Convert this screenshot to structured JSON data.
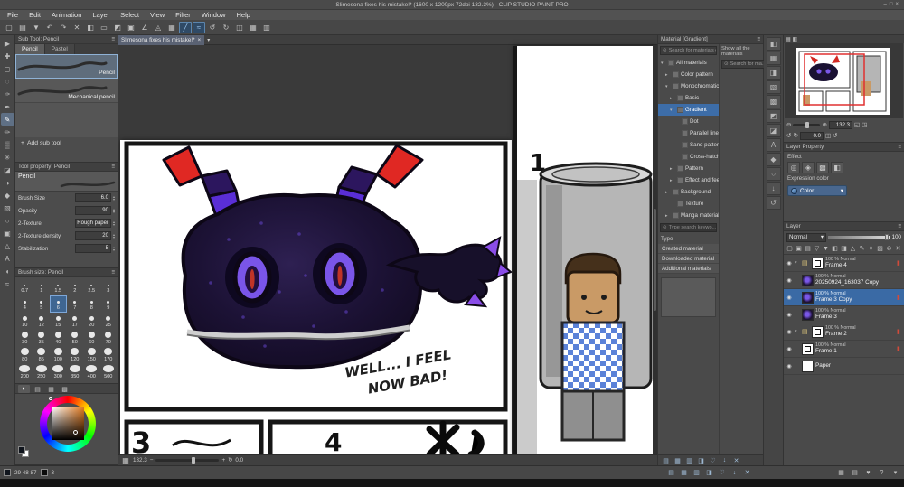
{
  "titlebar": {
    "title": "Slimesona fixes his mistake!* (1600 x 1200px 72dpi 132.3%) - CLIP STUDIO PAINT PRO",
    "minimize": "–",
    "maximize": "□",
    "close": "×"
  },
  "common": {
    "menu_icon": "≡",
    "eye_icon": "◉",
    "collapse_icon": "▾",
    "expand_icon": "▸",
    "pin_icon": "▮",
    "search_icon": "⊙",
    "plus_icon": "+",
    "up_icon": "▴",
    "down_icon": "▾",
    "close_icon": "×"
  },
  "colors": {
    "accent_blue": "#3a6aa5",
    "selection_red": "#e03030",
    "selected_color_orange": "#e0781e",
    "panel_gray": "#4a4a4a"
  },
  "menu": {
    "items": [
      "File",
      "Edit",
      "Animation",
      "Layer",
      "Select",
      "View",
      "Filter",
      "Window",
      "Help"
    ]
  },
  "toolbar": {
    "icons": [
      {
        "dn": "new-file-icon",
        "glyph": "▢"
      },
      {
        "dn": "open-file-icon",
        "glyph": "▤"
      },
      {
        "dn": "save-icon",
        "glyph": "▼"
      },
      {
        "dn": "undo-icon",
        "glyph": "↶"
      },
      {
        "dn": "redo-icon",
        "glyph": "↷"
      },
      {
        "dn": "delete-icon",
        "glyph": "✕"
      },
      {
        "dn": "fill-icon",
        "glyph": "◧"
      },
      {
        "dn": "deselect-icon",
        "glyph": "▭"
      },
      {
        "dn": "invert-selection-icon",
        "glyph": "◩"
      },
      {
        "dn": "selection-border-icon",
        "glyph": "▣"
      },
      {
        "dn": "snap-to-ruler-icon",
        "glyph": "∠"
      },
      {
        "dn": "snap-to-special-ruler-icon",
        "glyph": "◬"
      },
      {
        "dn": "snap-to-grid-icon",
        "glyph": "▦"
      },
      {
        "dn": "vector-snap-line-icon",
        "glyph": "╱",
        "active": true
      },
      {
        "dn": "vector-snap-curve-icon",
        "glyph": "≈",
        "active": true
      },
      {
        "dn": "rotate-left-icon",
        "glyph": "↺"
      },
      {
        "dn": "rotate-right-icon",
        "glyph": "↻"
      },
      {
        "dn": "flip-horizontal-icon",
        "glyph": "◫"
      },
      {
        "dn": "show-grid-icon",
        "glyph": "▦"
      },
      {
        "dn": "show-ruler-icon",
        "glyph": "▥"
      }
    ]
  },
  "tools": {
    "items": [
      {
        "dn": "operation-tool-icon",
        "glyph": "▶"
      },
      {
        "dn": "move-tool-icon",
        "glyph": "✚"
      },
      {
        "dn": "marquee-tool-icon",
        "glyph": "◻"
      },
      {
        "dn": "lasso-tool-icon",
        "glyph": "◌"
      },
      {
        "dn": "eyedropper-tool-icon",
        "glyph": "✑"
      },
      {
        "dn": "pen-tool-icon",
        "glyph": "✒"
      },
      {
        "dn": "pencil-tool-icon",
        "glyph": "✎",
        "active": true
      },
      {
        "dn": "brush-tool-icon",
        "glyph": "✏"
      },
      {
        "dn": "airbrush-tool-icon",
        "glyph": "▒"
      },
      {
        "dn": "decoration-tool-icon",
        "glyph": "✳"
      },
      {
        "dn": "eraser-tool-icon",
        "glyph": "◪"
      },
      {
        "dn": "blend-tool-icon",
        "glyph": "◑"
      },
      {
        "dn": "fill-tool-icon",
        "glyph": "◆"
      },
      {
        "dn": "gradient-tool-icon",
        "glyph": "▧"
      },
      {
        "dn": "figure-tool-icon",
        "glyph": "○"
      },
      {
        "dn": "frame-border-tool-icon",
        "glyph": "▣"
      },
      {
        "dn": "ruler-tool-icon",
        "glyph": "△"
      },
      {
        "dn": "text-tool-icon",
        "glyph": "A"
      },
      {
        "dn": "balloon-tool-icon",
        "glyph": "◖"
      },
      {
        "dn": "line-correction-tool-icon",
        "glyph": "≈"
      }
    ]
  },
  "subtool": {
    "title": "Sub Tool: Pencil",
    "tabs": [
      {
        "dn": "subtool-tab-pencil",
        "label": "Pencil",
        "active": true
      },
      {
        "dn": "subtool-tab-pastel",
        "label": "Pastel"
      }
    ],
    "items": [
      {
        "dn": "subtool-item-pencil",
        "name": "Pencil",
        "selected": true
      },
      {
        "dn": "subtool-item-mechanical-pencil",
        "name": "Mechanical pencil"
      }
    ],
    "add_label": "Add sub tool"
  },
  "tool_property": {
    "title": "Tool property: Pencil",
    "tool_name": "Pencil",
    "props": [
      {
        "dn": "brush-size-field",
        "label": "Brush Size",
        "value": "6.0"
      },
      {
        "dn": "opacity-field",
        "label": "Opacity",
        "value": "90"
      },
      {
        "dn": "texture-field",
        "label": "2-Texture",
        "value": "Rough paper"
      },
      {
        "dn": "texture-density-field",
        "label": "2-Texture density",
        "value": "20"
      },
      {
        "dn": "stabilization-field",
        "label": "Stabilization",
        "value": "5"
      }
    ]
  },
  "brush_size": {
    "title": "Brush size: Pencil",
    "sizes": [
      {
        "v": "0.7"
      },
      {
        "v": "1"
      },
      {
        "v": "1.5"
      },
      {
        "v": "2"
      },
      {
        "v": "2.5"
      },
      {
        "v": "3"
      },
      {
        "v": "4"
      },
      {
        "v": "5"
      },
      {
        "v": "6",
        "selected": true
      },
      {
        "v": "7"
      },
      {
        "v": "8"
      },
      {
        "v": "9"
      },
      {
        "v": "10"
      },
      {
        "v": "12"
      },
      {
        "v": "15"
      },
      {
        "v": "17"
      },
      {
        "v": "20"
      },
      {
        "v": "25"
      },
      {
        "v": "30"
      },
      {
        "v": "35"
      },
      {
        "v": "40"
      },
      {
        "v": "50"
      },
      {
        "v": "60"
      },
      {
        "v": "70"
      },
      {
        "v": "80"
      },
      {
        "v": "85"
      },
      {
        "v": "100"
      },
      {
        "v": "120"
      },
      {
        "v": "150"
      },
      {
        "v": "170"
      },
      {
        "v": "200"
      },
      {
        "v": "250"
      },
      {
        "v": "300"
      },
      {
        "v": "350"
      },
      {
        "v": "400"
      },
      {
        "v": "500"
      }
    ]
  },
  "color_panel": {
    "selected_color": "#e0781e",
    "tab_icons": [
      {
        "dn": "color-wheel-tab-icon",
        "glyph": "◐",
        "active": true
      },
      {
        "dn": "color-slider-tab-icon",
        "glyph": "▤"
      },
      {
        "dn": "color-set-tab-icon",
        "glyph": "▦"
      },
      {
        "dn": "intermediate-color-tab-icon",
        "glyph": "▩"
      }
    ]
  },
  "canvas": {
    "doc_tab": "Slimesona fixes his mistake!*",
    "zoom_value": "132.3",
    "rotate_value": "0.0",
    "speech_line1": "WELL... I FEEL",
    "speech_line2": "NOW BAD!",
    "panel1_label": "1",
    "panel3_label": "3",
    "panel4_label": "4"
  },
  "material": {
    "title": "Material [Gradient]",
    "search_placeholder": "Search for materials on ...",
    "show_all_label": "Show all the materials",
    "side_search_label": "Search for ma...",
    "tree": [
      {
        "dn": "material-tree-all-materials",
        "exp": "▾",
        "label": "All materials",
        "lvl": 0
      },
      {
        "dn": "material-tree-color-pattern",
        "exp": "▸",
        "label": "Color pattern",
        "lvl": 1
      },
      {
        "dn": "material-tree-monochromatic",
        "exp": "▾",
        "label": "Monochromatic",
        "lvl": 1
      },
      {
        "dn": "material-tree-basic",
        "exp": "▸",
        "label": "Basic",
        "lvl": 2
      },
      {
        "dn": "material-tree-gradient",
        "exp": "▾",
        "label": "Gradient",
        "lvl": 2,
        "selected": true
      },
      {
        "dn": "material-tree-dot",
        "exp": "",
        "label": "Dot",
        "lvl": 3
      },
      {
        "dn": "material-tree-parallel-lines",
        "exp": "",
        "label": "Parallel lines",
        "lvl": 3
      },
      {
        "dn": "material-tree-sand-pattern",
        "exp": "",
        "label": "Sand pattern",
        "lvl": 3
      },
      {
        "dn": "material-tree-cross-hatching",
        "exp": "",
        "label": "Cross-hatching",
        "lvl": 3
      },
      {
        "dn": "material-tree-pattern",
        "exp": "▸",
        "label": "Pattern",
        "lvl": 2
      },
      {
        "dn": "material-tree-effect-and-feeling",
        "exp": "▸",
        "label": "Effect and feeling",
        "lvl": 2
      },
      {
        "dn": "material-tree-background",
        "exp": "▸",
        "label": "Background",
        "lvl": 1
      },
      {
        "dn": "material-tree-texture",
        "exp": "",
        "label": "Texture",
        "lvl": 2
      },
      {
        "dn": "material-tree-manga-material",
        "exp": "▸",
        "label": "Manga material",
        "lvl": 1
      }
    ],
    "search2_placeholder": "Type search keywo...",
    "type_label": "Type",
    "type_items": [
      "Created material",
      "Downloaded material",
      "Additional materials"
    ],
    "footer_icons": [
      {
        "dn": "material-list-view-icon",
        "glyph": "▤"
      },
      {
        "dn": "material-grid-view-icon",
        "glyph": "▦"
      },
      {
        "dn": "material-detail-view-icon",
        "glyph": "▥"
      },
      {
        "dn": "material-paste-icon",
        "glyph": "◨"
      },
      {
        "dn": "material-favorite-icon",
        "glyph": "♡"
      },
      {
        "dn": "material-download-icon",
        "glyph": "↓"
      },
      {
        "dn": "material-delete-icon",
        "glyph": "✕"
      }
    ]
  },
  "side_strip": {
    "icons": [
      {
        "dn": "quick-access-tab-icon",
        "glyph": "◧"
      },
      {
        "dn": "material-color-pattern-tab-icon",
        "glyph": "▦"
      },
      {
        "dn": "material-monochromatic-tab-icon",
        "glyph": "◨"
      },
      {
        "dn": "material-gradient-tab-icon",
        "glyph": "▧"
      },
      {
        "dn": "material-manga-tab-icon",
        "glyph": "▩"
      },
      {
        "dn": "material-image-tab-icon",
        "glyph": "◩"
      },
      {
        "dn": "material-3d-tab-icon",
        "glyph": "◪"
      },
      {
        "dn": "material-text-tab-icon",
        "glyph": "A"
      },
      {
        "dn": "material-pose-tab-icon",
        "glyph": "◆"
      },
      {
        "dn": "material-primitive-tab-icon",
        "glyph": "○"
      },
      {
        "dn": "material-download-tab-icon",
        "glyph": "↓"
      },
      {
        "dn": "material-history-tab-icon",
        "glyph": "↺"
      }
    ]
  },
  "navigator": {
    "zoom_out_icon": "⊖",
    "zoom_in_icon": "⊕",
    "zoom_value": "132.3",
    "fit_icon": "◱",
    "full_icon": "◳",
    "rotate_left_icon": "↺",
    "rotate_right_icon": "↻",
    "rotate_value": "0.0",
    "flip_icon": "◫",
    "tab1_icon": "▦",
    "tab2_icon": "◧"
  },
  "layer_property": {
    "title": "Layer Property",
    "effect_label": "Effect",
    "effect_icons": [
      {
        "dn": "border-effect-icon",
        "glyph": "◎"
      },
      {
        "dn": "extract-line-icon",
        "glyph": "◈"
      },
      {
        "dn": "tone-effect-icon",
        "glyph": "▩"
      },
      {
        "dn": "layer-color-icon",
        "glyph": "◧"
      }
    ],
    "expression_label": "Expression color",
    "expression_value": "Color"
  },
  "layers": {
    "title": "Layer",
    "blend_mode": "Normal",
    "opacity_value": "100",
    "header_icons": [
      {
        "dn": "new-raster-layer-icon",
        "glyph": "▢"
      },
      {
        "dn": "new-vector-layer-icon",
        "glyph": "▣"
      },
      {
        "dn": "new-folder-icon",
        "glyph": "▤"
      },
      {
        "dn": "transfer-to-lower-layer-icon",
        "glyph": "▽"
      },
      {
        "dn": "combine-to-lower-layer-icon",
        "glyph": "▼"
      },
      {
        "dn": "create-mask-icon",
        "glyph": "◧"
      },
      {
        "dn": "apply-mask-icon",
        "glyph": "◨"
      },
      {
        "dn": "ruler-icon",
        "glyph": "△"
      },
      {
        "dn": "set-as-draft-icon",
        "glyph": "✎"
      },
      {
        "dn": "lock-layer-icon",
        "glyph": "◊"
      },
      {
        "dn": "lock-transparent-pixels-icon",
        "glyph": "▨"
      },
      {
        "dn": "enable-mask-icon",
        "glyph": "⊘"
      },
      {
        "dn": "delete-layer-icon",
        "glyph": "✕"
      }
    ],
    "items": [
      {
        "dn": "layer-frame-4",
        "info": "100 % Normal",
        "name": "Frame 4",
        "thumb": "frame",
        "folder": true,
        "red": true
      },
      {
        "dn": "layer-20250924-163037-copy",
        "info": "100 % Normal",
        "name": "20250924_163037 Copy",
        "thumb": "art"
      },
      {
        "dn": "layer-frame-3-copy",
        "info": "100 % Normal",
        "name": "Frame 3 Copy",
        "thumb": "art",
        "selected": true,
        "red": true
      },
      {
        "dn": "layer-frame-3",
        "info": "100 % Normal",
        "name": "Frame 3",
        "thumb": "art"
      },
      {
        "dn": "layer-frame-2",
        "info": "100 % Normal",
        "name": "Frame 2",
        "thumb": "frame",
        "folder": true,
        "red": true
      },
      {
        "dn": "layer-frame-1",
        "info": "100 % Normal",
        "name": "Frame 1",
        "thumb": "frame",
        "red": true
      },
      {
        "dn": "layer-paper",
        "info": "",
        "name": "Paper",
        "thumb": "white"
      }
    ]
  },
  "statusbar": {
    "rgb_values": "29 48 87",
    "extra_value": "3",
    "right_icons": [
      {
        "dn": "workspace-icon",
        "glyph": "▦"
      },
      {
        "dn": "gallery-icon",
        "glyph": "▤"
      },
      {
        "dn": "favorite-icon",
        "glyph": "♥"
      },
      {
        "dn": "help-icon",
        "glyph": "?"
      },
      {
        "dn": "collapse-icon",
        "glyph": "▾"
      }
    ]
  }
}
